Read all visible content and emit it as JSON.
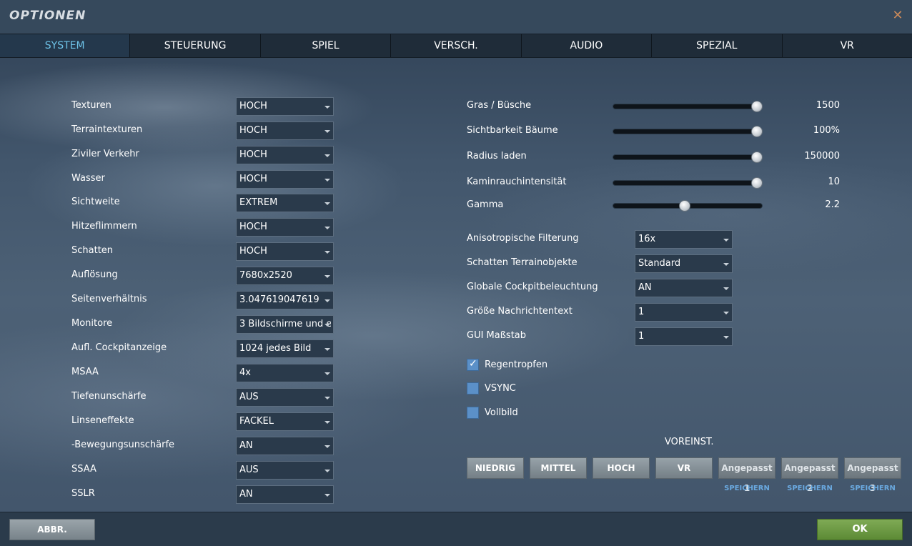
{
  "window": {
    "title": "OPTIONEN",
    "close_icon": "close-icon",
    "accent_color": "#6ec3e8"
  },
  "tabs": [
    {
      "label": "SYSTEM",
      "active": true
    },
    {
      "label": "STEUERUNG",
      "active": false
    },
    {
      "label": "SPIEL",
      "active": false
    },
    {
      "label": "VERSCH.",
      "active": false
    },
    {
      "label": "AUDIO",
      "active": false
    },
    {
      "label": "SPEZIAL",
      "active": false
    },
    {
      "label": "VR",
      "active": false
    }
  ],
  "left_settings": [
    {
      "label": "Texturen",
      "value": "HOCH"
    },
    {
      "label": "Terraintexturen",
      "value": "HOCH"
    },
    {
      "label": "Ziviler Verkehr",
      "value": "HOCH"
    },
    {
      "label": "Wasser",
      "value": "HOCH"
    },
    {
      "label": "Sichtweite",
      "value": "EXTREM"
    },
    {
      "label": "Hitzeflimmern",
      "value": "HOCH"
    },
    {
      "label": "Schatten",
      "value": "HOCH"
    },
    {
      "label": "Auflösung",
      "value": "7680x2520"
    },
    {
      "label": "Seitenverhältnis",
      "value": "3.047619047619"
    },
    {
      "label": "Monitore",
      "value": "3 Bildschirme und ei"
    },
    {
      "label": "Aufl. Cockpitanzeige",
      "value": "1024 jedes Bild"
    },
    {
      "label": "MSAA",
      "value": "4x"
    },
    {
      "label": "Tiefenunschärfe",
      "value": "AUS"
    },
    {
      "label": "Linseneffekte",
      "value": "FACKEL"
    },
    {
      "label": "-Bewegungsunschärfe",
      "value": "AN"
    },
    {
      "label": "SSAA",
      "value": "AUS"
    },
    {
      "label": "SSLR",
      "value": "AN"
    }
  ],
  "sliders": [
    {
      "label": "Gras / Büsche",
      "value": "1500",
      "level": 1.0
    },
    {
      "label": "Sichtbarkeit Bäume",
      "value": "100%",
      "level": 1.0
    },
    {
      "label": "Radius laden",
      "value": "150000",
      "level": 1.0
    },
    {
      "label": "Kaminrauchintensität",
      "value": "10",
      "level": 1.0
    },
    {
      "label": "Gamma",
      "value": "2.2",
      "level": 0.48
    }
  ],
  "right_settings": [
    {
      "label": "Anisotropische Filterung",
      "value": "16x"
    },
    {
      "label": "Schatten Terrainobjekte",
      "value": "Standard"
    },
    {
      "label": "Globale Cockpitbeleuchtung",
      "value": "AN"
    },
    {
      "label": "Größe Nachrichtentext",
      "value": "1"
    },
    {
      "label": "GUI Maßstab",
      "value": "1"
    }
  ],
  "checkboxes": [
    {
      "label": "Regentropfen",
      "checked": true
    },
    {
      "label": "VSYNC",
      "checked": false
    },
    {
      "label": "Vollbild",
      "checked": false
    }
  ],
  "presets": {
    "title": "VOREINST.",
    "buttons": [
      "NIEDRIG",
      "MITTEL",
      "HOCH",
      "VR"
    ],
    "custom": [
      {
        "label": "Angepasst 1",
        "save": "SPEICHERN"
      },
      {
        "label": "Angepasst 2",
        "save": "SPEICHERN"
      },
      {
        "label": "Angepasst 3",
        "save": "SPEICHERN"
      }
    ]
  },
  "footer": {
    "cancel_label": "ABBR.",
    "ok_label": "OK"
  }
}
